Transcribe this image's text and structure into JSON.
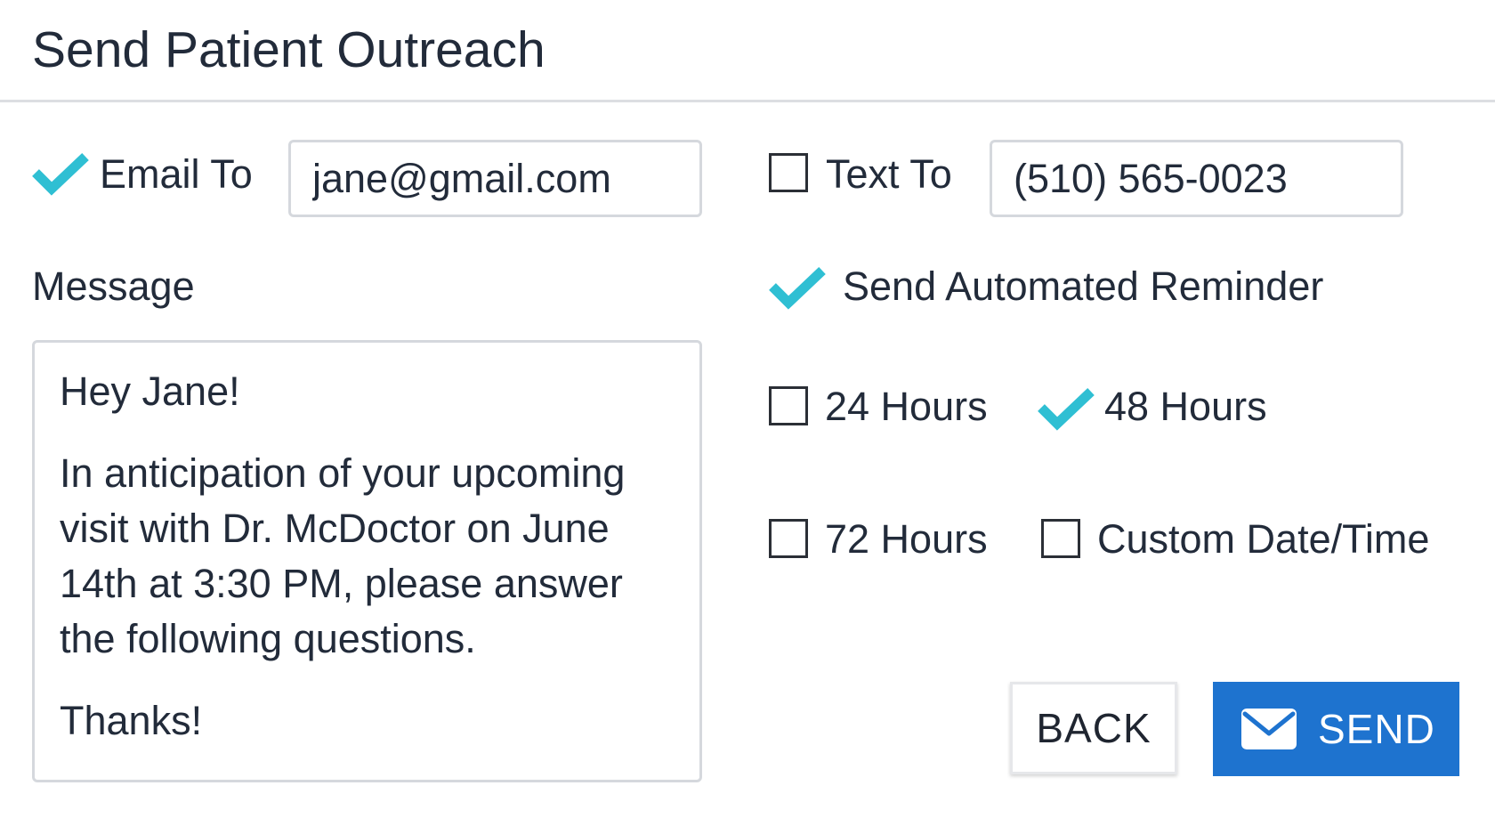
{
  "header": {
    "title": "Send Patient Outreach"
  },
  "email": {
    "label": "Email To",
    "value": "jane@gmail.com",
    "checked": true
  },
  "text": {
    "label": "Text To",
    "value": "(510) 565-0023",
    "checked": false
  },
  "message": {
    "label": "Message",
    "lines": [
      "Hey Jane!",
      "In anticipation of your upcoming visit with Dr. McDoctor on June 14th at 3:30 PM, please answer the following questions.",
      "Thanks!"
    ]
  },
  "reminder": {
    "label": "Send Automated Reminder",
    "checked": true,
    "options": [
      {
        "label": "24 Hours",
        "checked": false
      },
      {
        "label": "48 Hours",
        "checked": true
      },
      {
        "label": "72 Hours",
        "checked": false
      },
      {
        "label": "Custom Date/Time",
        "checked": false
      }
    ]
  },
  "actions": {
    "back_label": "BACK",
    "send_label": "SEND"
  },
  "colors": {
    "check": "#2fbfd3",
    "primary": "#1e73cf",
    "text": "#222b3a",
    "border": "#d5d8dd"
  }
}
